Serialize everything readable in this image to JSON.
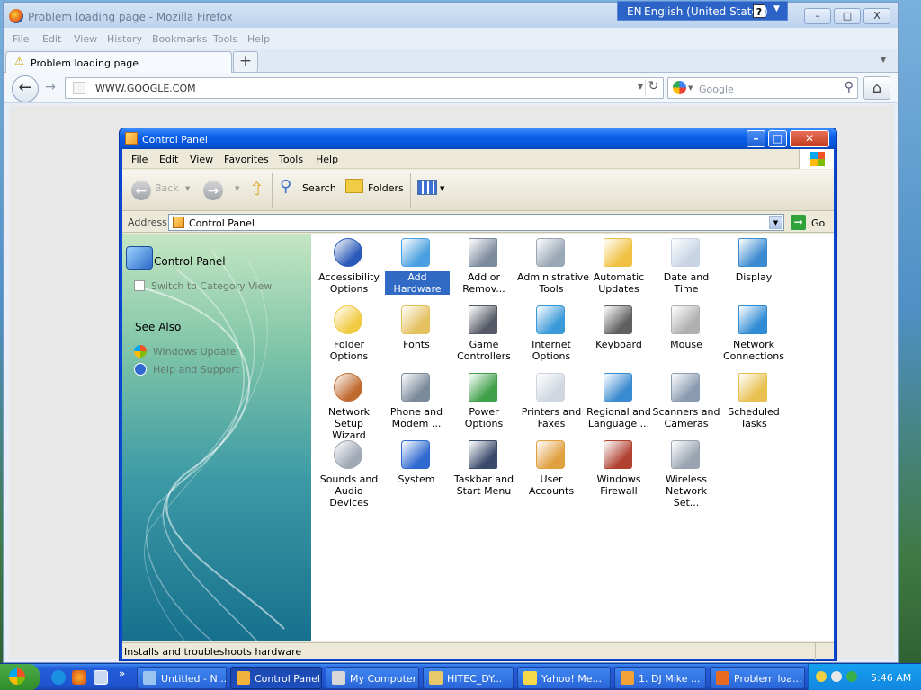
{
  "firefox": {
    "window_title": "Problem loading page - Mozilla Firefox",
    "menu": [
      "File",
      "Edit",
      "View",
      "History",
      "Bookmarks",
      "Tools",
      "Help"
    ],
    "tab_title": "Problem loading page",
    "new_tab": "+",
    "url": "WWW.GOOGLE.COM",
    "search_placeholder": "Google",
    "caption_min": "–",
    "caption_max": "□",
    "caption_close": "X"
  },
  "language_bar": {
    "code": "EN",
    "name": "English (United States)",
    "help": "?"
  },
  "control_panel": {
    "title": "Control Panel",
    "menu": [
      "File",
      "Edit",
      "View",
      "Favorites",
      "Tools",
      "Help"
    ],
    "toolbar": {
      "back": "Back",
      "search": "Search",
      "folders": "Folders"
    },
    "address_label": "Address",
    "address_value": "Control Panel",
    "go_label": "Go",
    "sidebar": {
      "title": "Control Panel",
      "switch_view": "Switch to Category View",
      "see_also": "See Also",
      "links": [
        "Windows Update",
        "Help and Support"
      ]
    },
    "items": [
      {
        "label": "Accessibility\nOptions",
        "icon": "accessibility-icon",
        "selected": false
      },
      {
        "label": "Add Hardware",
        "icon": "add-hardware-icon",
        "selected": true
      },
      {
        "label": "Add or\nRemov...",
        "icon": "add-remove-programs-icon",
        "selected": false
      },
      {
        "label": "Administrative\nTools",
        "icon": "administrative-tools-icon",
        "selected": false
      },
      {
        "label": "Automatic\nUpdates",
        "icon": "automatic-updates-icon",
        "selected": false
      },
      {
        "label": "Date and Time",
        "icon": "date-time-icon",
        "selected": false
      },
      {
        "label": "Display",
        "icon": "display-icon",
        "selected": false
      },
      {
        "label": "Folder Options",
        "icon": "folder-options-icon",
        "selected": false
      },
      {
        "label": "Fonts",
        "icon": "fonts-icon",
        "selected": false
      },
      {
        "label": "Game\nControllers",
        "icon": "game-controllers-icon",
        "selected": false
      },
      {
        "label": "Internet\nOptions",
        "icon": "internet-options-icon",
        "selected": false
      },
      {
        "label": "Keyboard",
        "icon": "keyboard-icon",
        "selected": false
      },
      {
        "label": "Mouse",
        "icon": "mouse-icon",
        "selected": false
      },
      {
        "label": "Network\nConnections",
        "icon": "network-connections-icon",
        "selected": false
      },
      {
        "label": "Network Setup\nWizard",
        "icon": "network-setup-wizard-icon",
        "selected": false
      },
      {
        "label": "Phone and\nModem ...",
        "icon": "phone-modem-icon",
        "selected": false
      },
      {
        "label": "Power Options",
        "icon": "power-options-icon",
        "selected": false
      },
      {
        "label": "Printers and\nFaxes",
        "icon": "printers-faxes-icon",
        "selected": false
      },
      {
        "label": "Regional and\nLanguage ...",
        "icon": "regional-language-icon",
        "selected": false
      },
      {
        "label": "Scanners and\nCameras",
        "icon": "scanners-cameras-icon",
        "selected": false
      },
      {
        "label": "Scheduled\nTasks",
        "icon": "scheduled-tasks-icon",
        "selected": false
      },
      {
        "label": "Sounds and\nAudio Devices",
        "icon": "sounds-audio-icon",
        "selected": false
      },
      {
        "label": "System",
        "icon": "system-icon",
        "selected": false
      },
      {
        "label": "Taskbar and\nStart Menu",
        "icon": "taskbar-start-menu-icon",
        "selected": false
      },
      {
        "label": "User Accounts",
        "icon": "user-accounts-icon",
        "selected": false
      },
      {
        "label": "Windows\nFirewall",
        "icon": "windows-firewall-icon",
        "selected": false
      },
      {
        "label": "Wireless\nNetwork Set...",
        "icon": "wireless-network-setup-icon",
        "selected": false
      }
    ],
    "status": "Installs and troubleshoots hardware"
  },
  "taskbar": {
    "buttons": [
      {
        "label": "Untitled - N...",
        "icon": "notepad-icon",
        "active": false
      },
      {
        "label": "Control Panel",
        "icon": "control-panel-icon",
        "active": true
      },
      {
        "label": "My Computer",
        "icon": "my-computer-icon",
        "active": false
      },
      {
        "label": "HITEC_DY...",
        "icon": "folder-icon",
        "active": false
      },
      {
        "label": "Yahoo! Me...",
        "icon": "yahoo-messenger-icon",
        "active": false
      },
      {
        "label": "1. DJ Mike ...",
        "icon": "media-player-icon",
        "active": false
      },
      {
        "label": "Problem loa...",
        "icon": "firefox-icon",
        "active": false
      }
    ],
    "clock": "5:46 AM",
    "overflow": "»"
  },
  "icon_colors": [
    "#2a5ab8",
    "#4aa0e0",
    "#7c8a9e",
    "#9aa7b5",
    "#f0c040",
    "#c8d4e4",
    "#3a8ad0",
    "#f2cb44",
    "#e4c060",
    "#555a66",
    "#3a9ad8",
    "#606060",
    "#b0b0b0",
    "#2f8bd4",
    "#c06a30",
    "#7a8a9a",
    "#3fa04a",
    "#cfd6e0",
    "#3a8ad0",
    "#8a9ab0",
    "#e8c050",
    "#a0a8b4",
    "#2f6ad0",
    "#3a4a6a",
    "#e0a040",
    "#b04030",
    "#9aa4b0"
  ]
}
